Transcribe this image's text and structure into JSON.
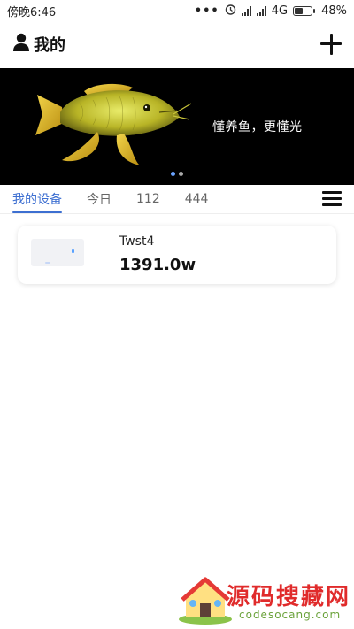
{
  "status_bar": {
    "time": "傍晚6:46",
    "network": "4G",
    "battery": "48%"
  },
  "header": {
    "title": "我的"
  },
  "banner": {
    "slogan": "懂养鱼，更懂光"
  },
  "tabs": [
    {
      "label": "我的设备",
      "active": true
    },
    {
      "label": "今日",
      "active": false
    },
    {
      "label": "112",
      "active": false
    },
    {
      "label": "444",
      "active": false
    }
  ],
  "devices": [
    {
      "name": "Twst4",
      "power": "1391.0w"
    }
  ],
  "watermark": {
    "title": "源码搜藏网",
    "url": "codesocang.com"
  },
  "colors": {
    "accent": "#3d6fd1",
    "banner_bg": "#000000",
    "watermark_red": "#e02b2b",
    "watermark_green": "#6aa23a"
  }
}
